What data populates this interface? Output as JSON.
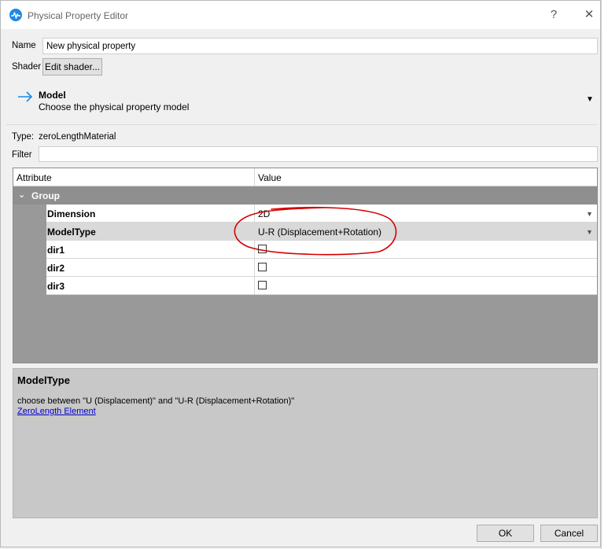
{
  "window": {
    "title": "Physical Property Editor",
    "help_glyph": "?",
    "close_glyph": "✕"
  },
  "form": {
    "name_label": "Name",
    "name_value": "New physical property",
    "shader_label": "Shader",
    "shader_button": "Edit shader..."
  },
  "model": {
    "title": "Model",
    "subtitle": "Choose the physical property model",
    "dropdown_glyph": "▼"
  },
  "type": {
    "label": "Type:",
    "value": "zeroLengthMaterial"
  },
  "filter": {
    "label": "Filter",
    "value": ""
  },
  "grid": {
    "col_attribute": "Attribute",
    "col_value": "Value",
    "group_label": "Group",
    "group_chevron": "⌄",
    "rows": [
      {
        "name": "Dimension",
        "value": "2D",
        "dropdown": "▼"
      },
      {
        "name": "ModelType",
        "value": "U-R (Displacement+Rotation)",
        "dropdown": "▼"
      },
      {
        "name": "dir1",
        "checked": false
      },
      {
        "name": "dir2",
        "checked": false
      },
      {
        "name": "dir3",
        "checked": false
      }
    ]
  },
  "description": {
    "title": "ModelType",
    "text": "choose between \"U (Displacement)\" and \"U-R (Displacement+Rotation)\"",
    "link": "ZeroLength Element"
  },
  "buttons": {
    "ok": "OK",
    "cancel": "Cancel"
  },
  "colors": {
    "accent": "#1e88e5",
    "annotation": "#d40000",
    "group_bg": "#8f8f8f",
    "link": "#0000cc"
  }
}
